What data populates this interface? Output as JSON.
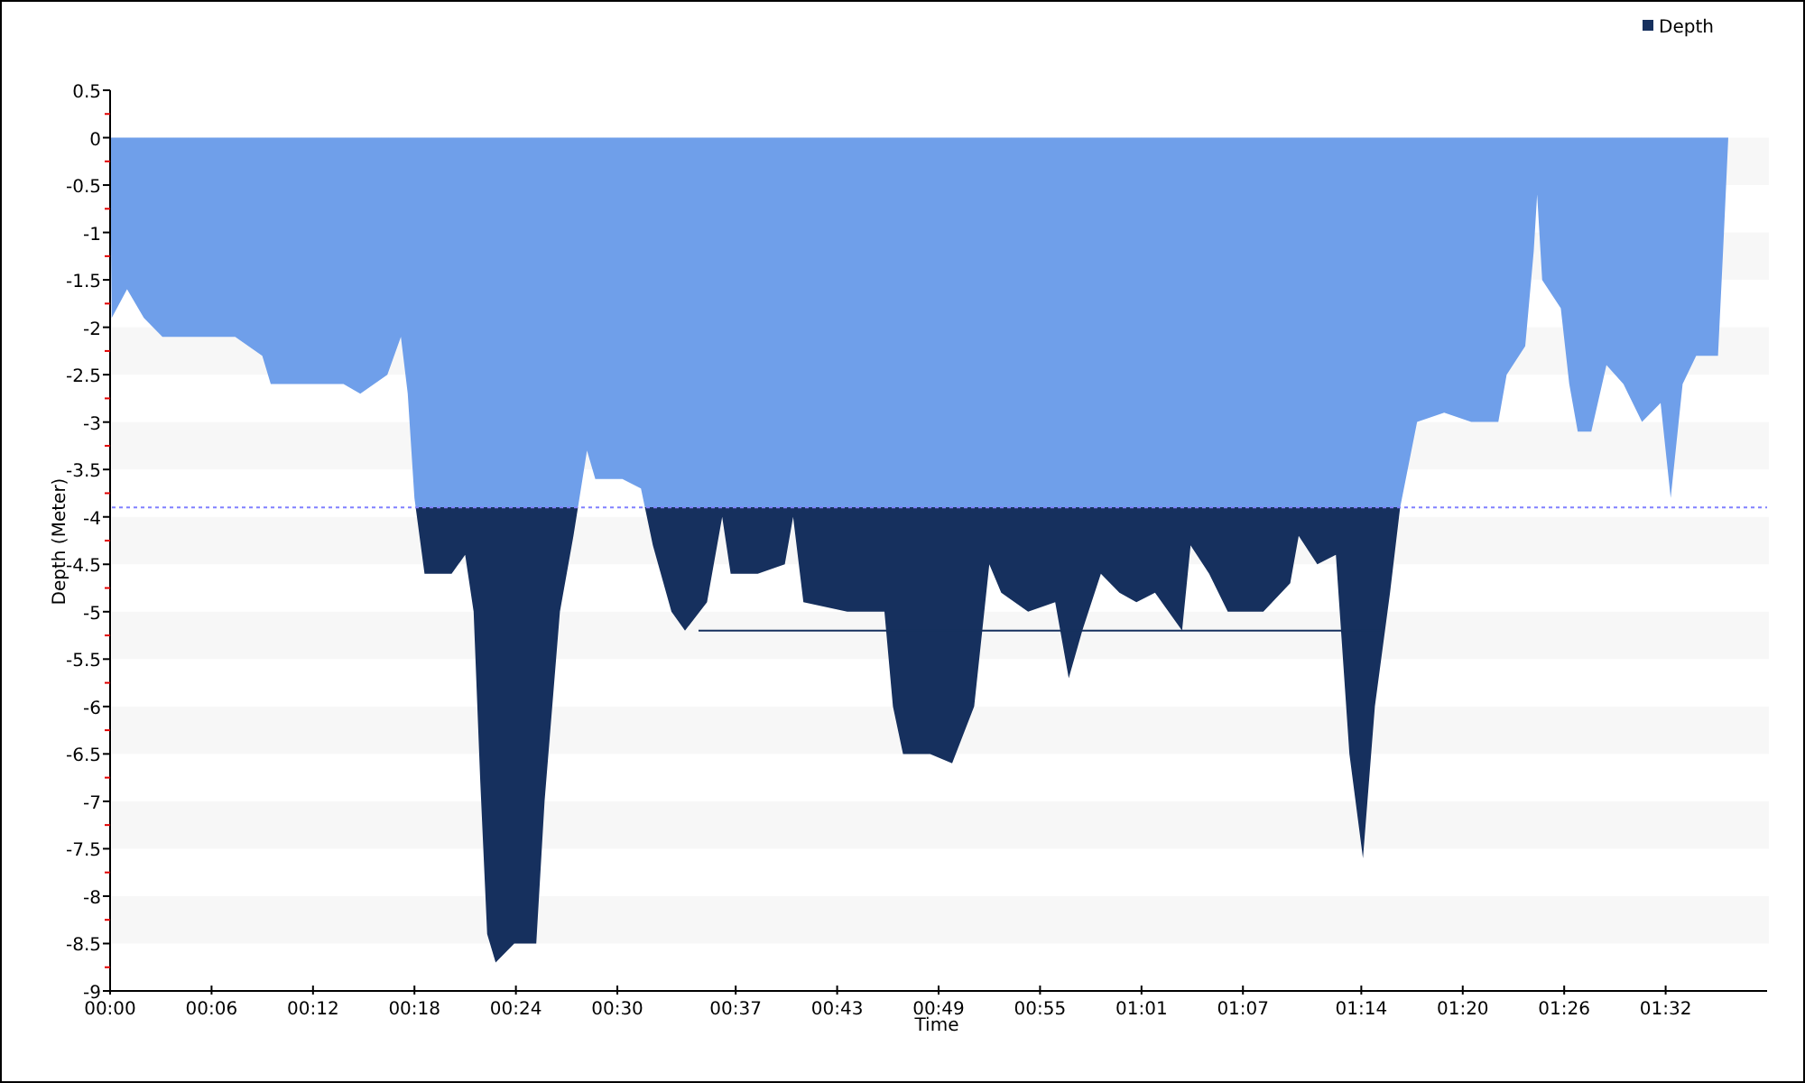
{
  "chart_data": {
    "type": "area",
    "xlabel": "Time",
    "ylabel": "Depth (Meter)",
    "x": [
      0,
      0.1,
      1.0,
      2.0,
      3.1,
      5.2,
      7.4,
      9.0,
      9.5,
      11.6,
      13.8,
      14.8,
      16.4,
      17.2,
      17.6,
      18.0,
      18.6,
      20.2,
      21.0,
      21.5,
      21.9,
      22.3,
      22.8,
      23.9,
      25.2,
      25.7,
      26.6,
      27.4,
      28.2,
      28.7,
      30.3,
      31.4,
      32.1,
      33.2,
      34.0,
      35.3,
      36.2,
      36.7,
      38.3,
      39.9,
      40.4,
      41.0,
      43.6,
      45.8,
      46.3,
      46.9,
      48.5,
      49.8,
      51.1,
      52.0,
      52.7,
      54.3,
      55.9,
      56.7,
      57.5,
      58.6,
      59.7,
      60.7,
      61.8,
      63.4,
      63.9,
      65.0,
      66.1,
      68.2,
      69.8,
      70.3,
      71.4,
      72.5,
      73.3,
      74.1,
      74.8,
      75.7,
      76.3,
      77.3,
      78.9,
      80.5,
      82.1,
      82.6,
      83.7,
      84.2,
      84.4,
      84.7,
      85.8,
      86.3,
      86.8,
      87.6,
      88.5,
      89.5,
      90.6,
      91.7,
      92.3,
      93.0,
      93.8,
      95.1,
      95.4,
      95.7
    ],
    "series": [
      {
        "name": "Depth",
        "color": "#6f9fea",
        "values": [
          0,
          -1.9,
          -1.6,
          -1.9,
          -2.1,
          -2.1,
          -2.1,
          -2.3,
          -2.6,
          -2.6,
          -2.6,
          -2.7,
          -2.5,
          -2.1,
          -2.7,
          -3.8,
          -4.6,
          -4.6,
          -4.4,
          -5.0,
          -6.8,
          -8.4,
          -8.7,
          -8.5,
          -8.5,
          -7.0,
          -5.0,
          -4.2,
          -3.3,
          -3.6,
          -3.6,
          -3.7,
          -4.3,
          -5.0,
          -5.2,
          -4.9,
          -4.0,
          -4.6,
          -4.6,
          -4.5,
          -4.0,
          -4.9,
          -5.0,
          -5.0,
          -6.0,
          -6.5,
          -6.5,
          -6.6,
          -6.0,
          -4.5,
          -4.8,
          -5.0,
          -4.9,
          -5.7,
          -5.2,
          -4.6,
          -4.8,
          -4.9,
          -4.8,
          -5.2,
          -4.3,
          -4.6,
          -5.0,
          -5.0,
          -4.7,
          -4.2,
          -4.5,
          -4.4,
          -6.5,
          -7.6,
          -6.0,
          -4.8,
          -3.9,
          -3.0,
          -2.9,
          -3.0,
          -3.0,
          -2.5,
          -2.2,
          -1.2,
          -0.6,
          -1.5,
          -1.8,
          -2.6,
          -3.1,
          -3.1,
          -2.4,
          -2.6,
          -3.0,
          -2.8,
          -3.8,
          -2.6,
          -2.3,
          -2.3,
          -1.2,
          0
        ]
      }
    ],
    "xlim": [
      0,
      98
    ],
    "ylim": [
      -9,
      0.5
    ],
    "xticks": [
      {
        "value": 0,
        "label": "00:00"
      },
      {
        "value": 6,
        "label": "00:06"
      },
      {
        "value": 12,
        "label": "00:12"
      },
      {
        "value": 18,
        "label": "00:18"
      },
      {
        "value": 24,
        "label": "00:24"
      },
      {
        "value": 30,
        "label": "00:30"
      },
      {
        "value": 37,
        "label": "00:37"
      },
      {
        "value": 43,
        "label": "00:43"
      },
      {
        "value": 49,
        "label": "00:49"
      },
      {
        "value": 55,
        "label": "00:55"
      },
      {
        "value": 61,
        "label": "01:01"
      },
      {
        "value": 67,
        "label": "01:07"
      },
      {
        "value": 74,
        "label": "01:14"
      },
      {
        "value": 80,
        "label": "01:20"
      },
      {
        "value": 86,
        "label": "01:26"
      },
      {
        "value": 92,
        "label": "01:32"
      }
    ],
    "yticks": [
      0.5,
      0,
      -0.5,
      -1,
      -1.5,
      -2,
      -2.5,
      -3,
      -3.5,
      -4,
      -4.5,
      -5,
      -5.5,
      -6,
      -6.5,
      -7,
      -7.5,
      -8,
      -8.5,
      -9
    ],
    "ref_lines": [
      {
        "axis": "y",
        "value": -3.9
      },
      {
        "axis": "y",
        "value": -5.2
      }
    ]
  }
}
